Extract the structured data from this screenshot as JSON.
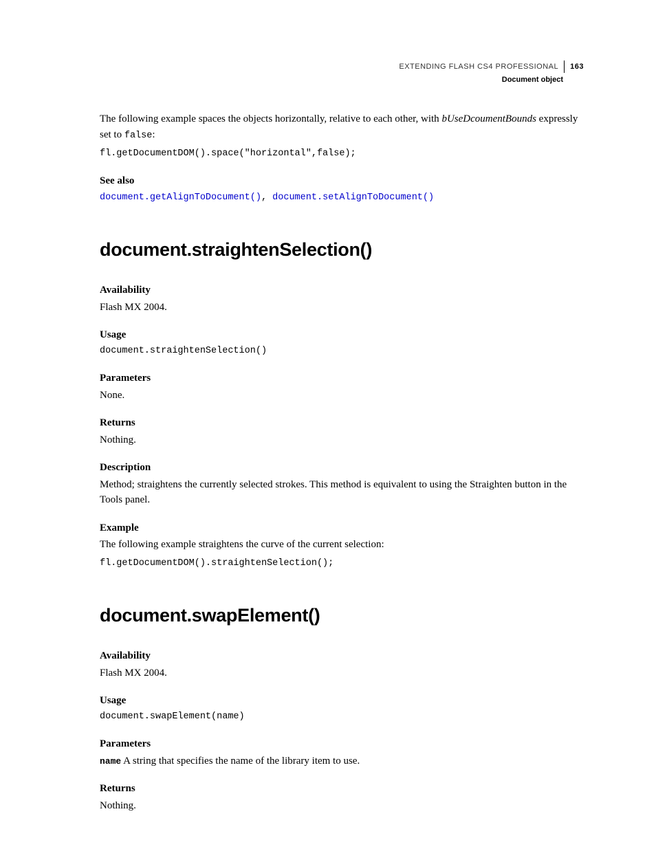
{
  "header": {
    "title": "EXTENDING FLASH CS4 PROFESSIONAL",
    "pageNumber": "163",
    "subtitle": "Document object"
  },
  "intro": {
    "para_pre": "The following example spaces the objects horizontally, relative to each other, with ",
    "para_em": "bUseDcoumentBounds",
    "para_post1": " expressly set to ",
    "para_code": "false",
    "para_post2": ":",
    "codeBlock": "fl.getDocumentDOM().space(\"horizontal\",false);",
    "seeAlsoLabel": "See also",
    "link1": "document.getAlignToDocument()",
    "sep": ", ",
    "link2": "document.setAlignToDocument()"
  },
  "method1": {
    "heading": "document.straightenSelection()",
    "availability": {
      "label": "Availability",
      "body": "Flash MX 2004."
    },
    "usage": {
      "label": "Usage",
      "code": "document.straightenSelection()"
    },
    "parameters": {
      "label": "Parameters",
      "body": "None."
    },
    "returns": {
      "label": "Returns",
      "body": "Nothing."
    },
    "description": {
      "label": "Description",
      "body": "Method; straightens the currently selected strokes. This method is equivalent to using the Straighten button in the Tools panel."
    },
    "example": {
      "label": "Example",
      "body": "The following example straightens the curve of the current selection:",
      "code": "fl.getDocumentDOM().straightenSelection();"
    }
  },
  "method2": {
    "heading": "document.swapElement()",
    "availability": {
      "label": "Availability",
      "body": "Flash MX 2004."
    },
    "usage": {
      "label": "Usage",
      "code": "document.swapElement(name)"
    },
    "parameters": {
      "label": "Parameters",
      "paramName": "name",
      "paramDesc": "  A string that specifies the name of the library item to use."
    },
    "returns": {
      "label": "Returns",
      "body": "Nothing."
    }
  }
}
